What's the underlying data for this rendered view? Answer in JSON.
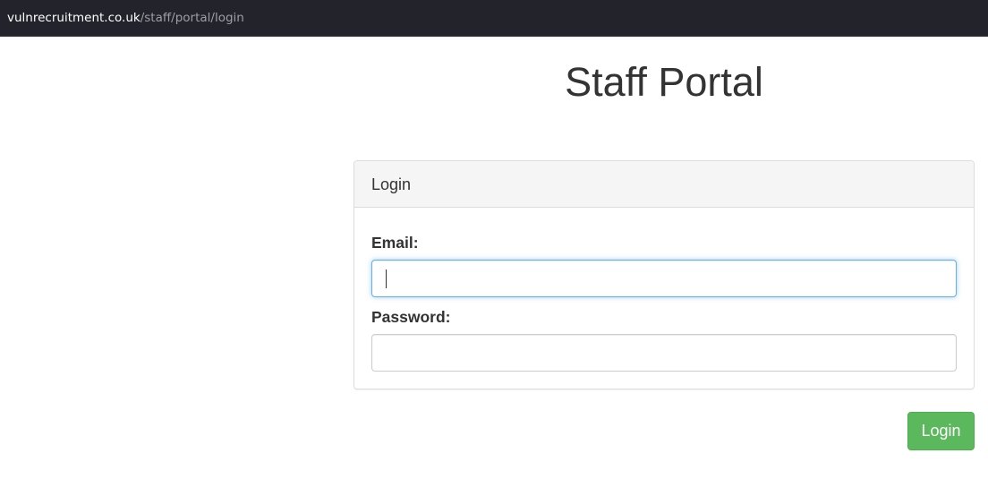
{
  "browser": {
    "url_host": "vulnrecruitment.co.uk",
    "url_path": "/staff/portal/login"
  },
  "page": {
    "title": "Staff Portal"
  },
  "login_panel": {
    "heading": "Login",
    "email": {
      "label": "Email:",
      "value": "",
      "focused": true
    },
    "password": {
      "label": "Password:",
      "value": ""
    }
  },
  "actions": {
    "login_label": "Login",
    "login_color": "#5cb85c"
  }
}
